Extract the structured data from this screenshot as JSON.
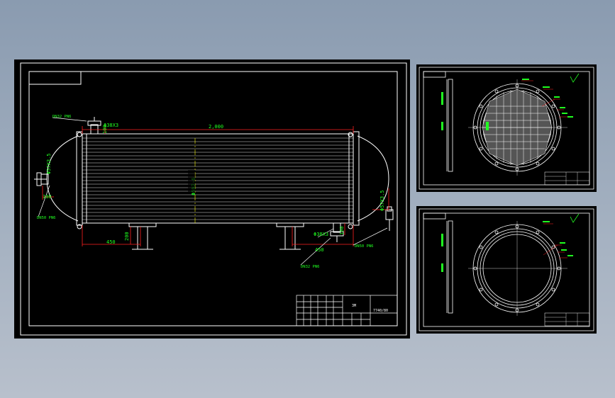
{
  "main_drawing": {
    "nozzle_top_left": "DN32 PN6",
    "tube_top": "Φ38X3",
    "dim_100_top": "100",
    "overall_length": "2,000",
    "shell_left": "Φ57X3.5",
    "dim_100_left": "100",
    "nozzle_left": "DN50 PN6",
    "shell_diameter": "Φ592-6",
    "shell_right": "Φ57X3.5",
    "nozzle_right": "DN50 PN6",
    "dim_200": "200",
    "dim_450_left": "450",
    "tube_bottom": "Φ38X3",
    "dim_100_bottom": "100",
    "dim_450_right": "450",
    "nozzle_bottom": "DN32 PN6"
  },
  "title_block": {
    "name": "3M",
    "code": "7740/80"
  },
  "colors": {
    "background": "#000000",
    "line": "#ffffff",
    "dimension": "#ff2020",
    "text": "#20ff20",
    "centerline": "#ffff00"
  }
}
